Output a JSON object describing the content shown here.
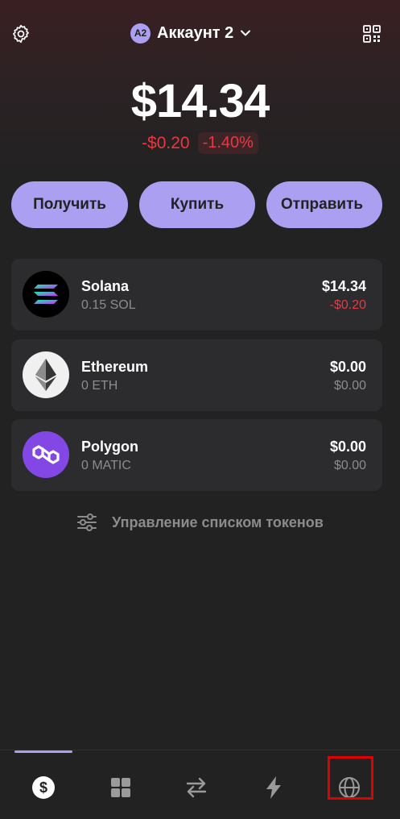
{
  "header": {
    "avatar_initials": "A2",
    "account_name": "Аккаунт 2",
    "icons": {
      "settings": "gear-icon",
      "dropdown": "chevron-down-icon",
      "qr": "qr-code-icon"
    }
  },
  "balance": {
    "total": "$14.34",
    "change_amount": "-$0.20",
    "change_percent": "-1.40%"
  },
  "actions": {
    "receive_label": "Получить",
    "buy_label": "Купить",
    "send_label": "Отправить"
  },
  "tokens": [
    {
      "name": "Solana",
      "amount": "0.15 SOL",
      "value": "$14.34",
      "change": "-$0.20",
      "icon": "solana-logo-icon"
    },
    {
      "name": "Ethereum",
      "amount": "0 ETH",
      "value": "$0.00",
      "change": "$0.00",
      "icon": "ethereum-logo-icon"
    },
    {
      "name": "Polygon",
      "amount": "0 MATIC",
      "value": "$0.00",
      "change": "$0.00",
      "icon": "polygon-logo-icon"
    }
  ],
  "manage_tokens_label": "Управление списком токенов",
  "bottom_nav": [
    {
      "name": "wallet",
      "icon": "dollar-circle-icon",
      "active": true
    },
    {
      "name": "collectibles",
      "icon": "grid-icon",
      "active": false
    },
    {
      "name": "swap",
      "icon": "swap-arrows-icon",
      "active": false
    },
    {
      "name": "activity",
      "icon": "lightning-icon",
      "active": false
    },
    {
      "name": "browser",
      "icon": "globe-icon",
      "active": false,
      "highlighted": true
    }
  ],
  "colors": {
    "accent": "#ab9ff2",
    "negative": "#eb3742",
    "background": "#222222",
    "card": "#2c2c2e",
    "muted_text": "#8c8c8c",
    "highlight_box": "#e00000"
  }
}
